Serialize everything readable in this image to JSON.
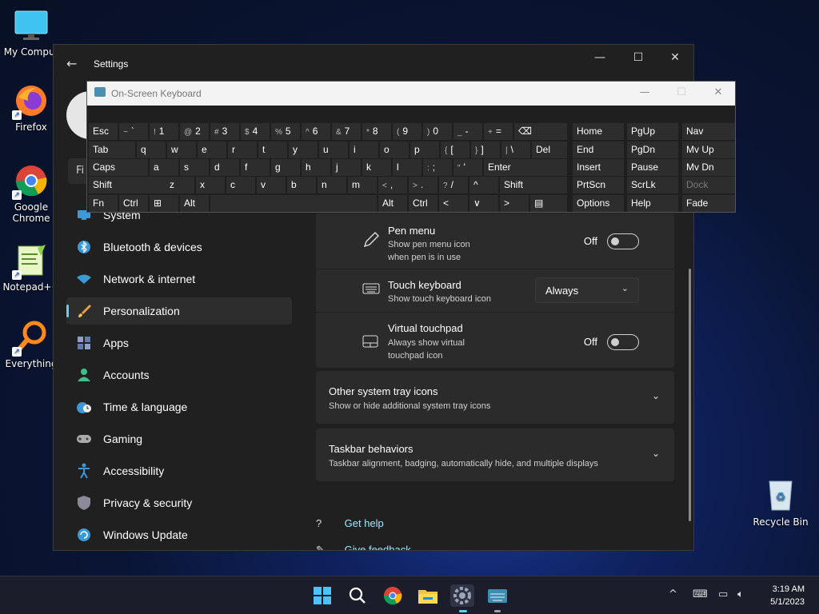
{
  "desktop": {
    "icons": [
      {
        "label": "My Comput"
      },
      {
        "label": "Firefox"
      },
      {
        "label": "Google Chrome"
      },
      {
        "label": "Notepad++"
      },
      {
        "label": "Everything"
      }
    ],
    "recycle_bin": "Recycle Bin"
  },
  "settings": {
    "title": "Settings",
    "find_placeholder": "Fi",
    "nav": [
      {
        "label": "System",
        "icon": "monitor-icon",
        "color": "#3a9ad9"
      },
      {
        "label": "Bluetooth & devices",
        "icon": "bluetooth-icon",
        "color": "#3a9ad9"
      },
      {
        "label": "Network & internet",
        "icon": "wifi-icon",
        "color": "#3a9ad9"
      },
      {
        "label": "Personalization",
        "icon": "brush-icon",
        "color": "#e6a14a"
      },
      {
        "label": "Apps",
        "icon": "apps-icon",
        "color": "#8aa0c8"
      },
      {
        "label": "Accounts",
        "icon": "person-icon",
        "color": "#3ec08a"
      },
      {
        "label": "Time & language",
        "icon": "clock-globe-icon",
        "color": "#3a9ad9"
      },
      {
        "label": "Gaming",
        "icon": "gamepad-icon",
        "color": "#aaaaaa"
      },
      {
        "label": "Accessibility",
        "icon": "accessibility-icon",
        "color": "#3a9ad9"
      },
      {
        "label": "Privacy & security",
        "icon": "shield-icon",
        "color": "#8a8a9a"
      },
      {
        "label": "Windows Update",
        "icon": "update-icon",
        "color": "#3a9ad9"
      }
    ],
    "rows": {
      "pen_menu": {
        "title": "Pen menu",
        "desc1": "Show pen menu icon",
        "desc2": "when pen is in use",
        "state": "Off"
      },
      "touch_keyboard": {
        "title": "Touch keyboard",
        "desc": "Show touch keyboard icon",
        "value": "Always"
      },
      "virtual_touchpad": {
        "title": "Virtual touchpad",
        "desc1": "Always show virtual",
        "desc2": "touchpad icon",
        "state": "Off"
      }
    },
    "other_tray": {
      "title": "Other system tray icons",
      "desc": "Show or hide additional system tray icons"
    },
    "taskbar_behaviors": {
      "title": "Taskbar behaviors",
      "desc": "Taskbar alignment, badging, automatically hide, and multiple displays"
    },
    "get_help": "Get help",
    "give_feedback": "Give feedback"
  },
  "osk": {
    "title": "On-Screen Keyboard",
    "rows": [
      [
        "Esc",
        "~ `",
        "! 1",
        "@ 2",
        "# 3",
        "$ 4",
        "% 5",
        "^ 6",
        "& 7",
        "* 8",
        "( 9",
        ") 0",
        "_ -",
        "+ =",
        "⌫",
        "Home",
        "PgUp",
        "Nav"
      ],
      [
        "Tab",
        "q",
        "w",
        "e",
        "r",
        "t",
        "y",
        "u",
        "i",
        "o",
        "p",
        "{ [",
        "} ]",
        "| \\",
        "Del",
        "End",
        "PgDn",
        "Mv Up"
      ],
      [
        "Caps",
        "a",
        "s",
        "d",
        "f",
        "g",
        "h",
        "j",
        "k",
        "l",
        ": ;",
        "\" '",
        "Enter",
        "Insert",
        "Pause",
        "Mv Dn"
      ],
      [
        "Shift",
        "z",
        "x",
        "c",
        "v",
        "b",
        "n",
        "m",
        "< ,",
        "> .",
        "? /",
        "^",
        "Shift",
        "PrtScn",
        "ScrLk",
        "Dock"
      ],
      [
        "Fn",
        "Ctrl",
        "⊞",
        "Alt",
        "",
        "Alt",
        "Ctrl",
        "<",
        "∨",
        ">",
        "▤",
        "Options",
        "Help",
        "Fade"
      ]
    ]
  },
  "taskbar": {
    "time": "3:19 AM",
    "date": "5/1/2023"
  }
}
